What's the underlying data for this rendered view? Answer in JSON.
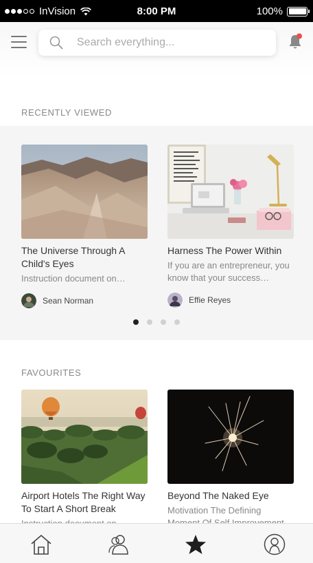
{
  "status_bar": {
    "carrier": "InVision",
    "time": "8:00 PM",
    "battery": "100%",
    "battery_level": 1.0
  },
  "header": {
    "menu_icon": "hamburger-menu-icon",
    "search_placeholder": "Search everything...",
    "search_icon": "search-icon",
    "notification_icon": "bell-icon",
    "notification_badge_color": "#e94e4e"
  },
  "recently_viewed": {
    "title": "RECENTLY VIEWED",
    "cards": [
      {
        "title": "The Universe Through A Child's Eyes",
        "description": "Instruction document on…",
        "author": "Sean Norman"
      },
      {
        "title": "Harness The Power Within",
        "description": "If you are an entrepreneur, you know that your success…",
        "author": "Effie Reyes"
      }
    ],
    "pager": {
      "count": 4,
      "active": 1
    }
  },
  "favourites": {
    "title": "FAVOURITES",
    "cards": [
      {
        "title": "Airport Hotels The Right Way To Start A Short Break",
        "description": "Instruction document on…"
      },
      {
        "title": "Beyond The Naked Eye",
        "description": "Motivation The Defining Moment Of Self Improvement"
      }
    ]
  },
  "tab_bar": {
    "tabs": [
      {
        "icon": "home-icon",
        "active": false
      },
      {
        "icon": "people-icon",
        "active": false
      },
      {
        "icon": "star-icon",
        "active": true
      },
      {
        "icon": "profile-icon",
        "active": false
      }
    ]
  }
}
